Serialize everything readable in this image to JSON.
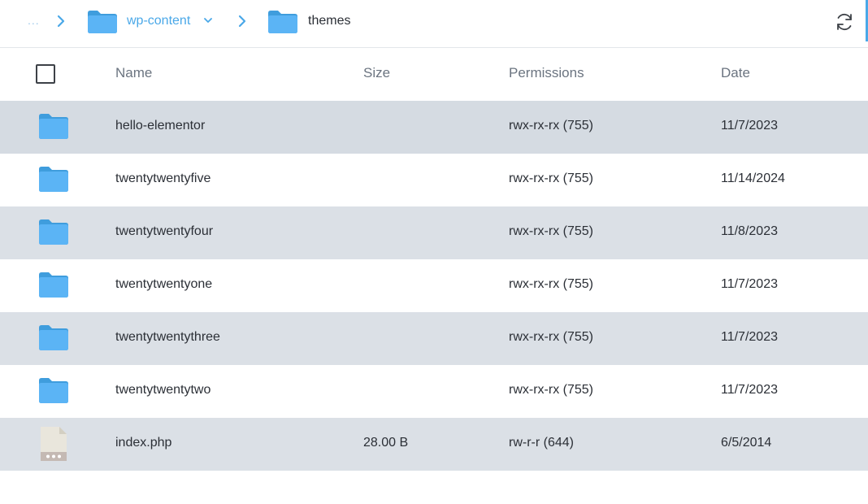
{
  "breadcrumb": {
    "ellipsis": "...",
    "parent_label": "wp-content",
    "current_label": "themes"
  },
  "colors": {
    "accent": "#4aa8e8",
    "folder": "#5bb4f5",
    "row_shade": "#dbe0e6"
  },
  "icons": {
    "refresh": "refresh-icon",
    "folder": "folder-icon",
    "file": "file-icon",
    "chevron": "chevron-right-icon",
    "dropdown": "chevron-down-icon"
  },
  "table": {
    "columns": [
      "Name",
      "Size",
      "Permissions",
      "Date"
    ],
    "rows": [
      {
        "type": "folder",
        "name": "hello-elementor",
        "size": "",
        "permissions": "rwx-rx-rx (755)",
        "date": "11/7/2023"
      },
      {
        "type": "folder",
        "name": "twentytwentyfive",
        "size": "",
        "permissions": "rwx-rx-rx (755)",
        "date": "11/14/2024"
      },
      {
        "type": "folder",
        "name": "twentytwentyfour",
        "size": "",
        "permissions": "rwx-rx-rx (755)",
        "date": "11/8/2023"
      },
      {
        "type": "folder",
        "name": "twentytwentyone",
        "size": "",
        "permissions": "rwx-rx-rx (755)",
        "date": "11/7/2023"
      },
      {
        "type": "folder",
        "name": "twentytwentythree",
        "size": "",
        "permissions": "rwx-rx-rx (755)",
        "date": "11/7/2023"
      },
      {
        "type": "folder",
        "name": "twentytwentytwo",
        "size": "",
        "permissions": "rwx-rx-rx (755)",
        "date": "11/7/2023"
      },
      {
        "type": "file",
        "name": "index.php",
        "size": "28.00 B",
        "permissions": "rw-r-r (644)",
        "date": "6/5/2014"
      }
    ]
  }
}
